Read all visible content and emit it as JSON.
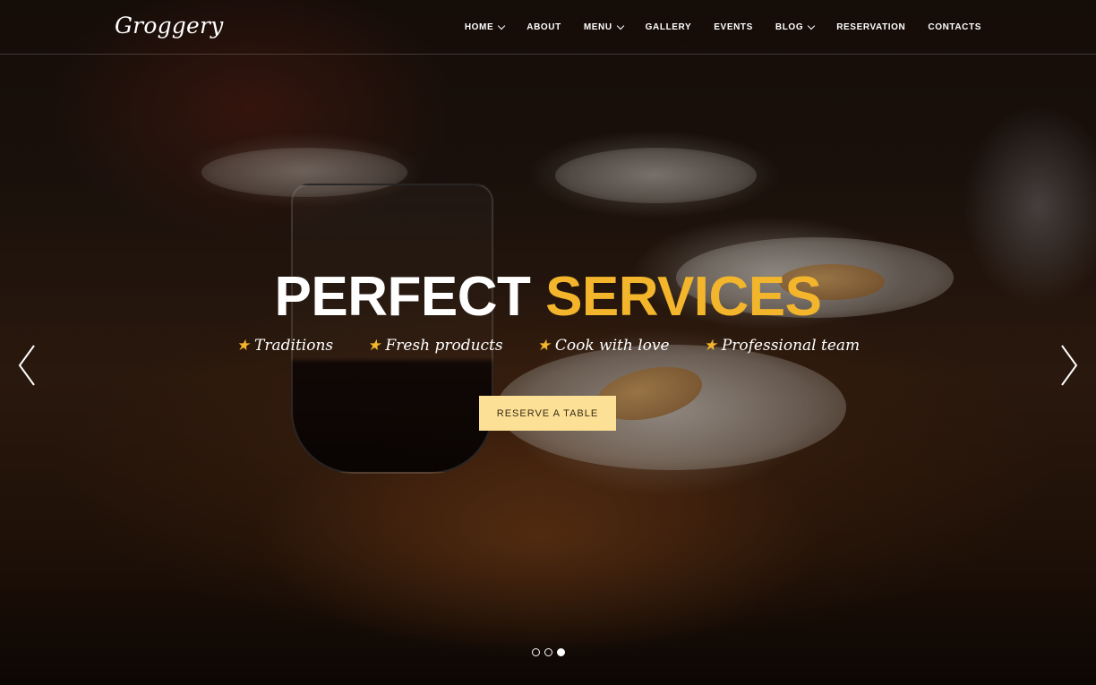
{
  "brand": {
    "logo_text": "Groggery"
  },
  "nav": {
    "items": [
      {
        "label": "HOME",
        "has_dropdown": true
      },
      {
        "label": "ABOUT",
        "has_dropdown": false
      },
      {
        "label": "MENU",
        "has_dropdown": true
      },
      {
        "label": "GALLERY",
        "has_dropdown": false
      },
      {
        "label": "EVENTS",
        "has_dropdown": false
      },
      {
        "label": "BLOG",
        "has_dropdown": true
      },
      {
        "label": "RESERVATION",
        "has_dropdown": false
      },
      {
        "label": "CONTACTS",
        "has_dropdown": false
      }
    ]
  },
  "hero": {
    "headline_white": "PERFECT",
    "headline_accent": "SERVICES",
    "features": [
      {
        "icon": "star-icon",
        "label": "Traditions"
      },
      {
        "icon": "star-icon",
        "label": "Fresh products"
      },
      {
        "icon": "star-icon",
        "label": "Cook with love"
      },
      {
        "icon": "star-icon",
        "label": "Professional team"
      }
    ],
    "cta_label": "RESERVE A TABLE"
  },
  "slider": {
    "slide_count": 3,
    "active_slide": 3,
    "prev_icon": "chevron-left-icon",
    "next_icon": "chevron-right-icon"
  },
  "colors": {
    "accent": "#f3b52b",
    "button_bg": "#fbe096",
    "button_text": "#3a2a14",
    "text": "#ffffff"
  }
}
